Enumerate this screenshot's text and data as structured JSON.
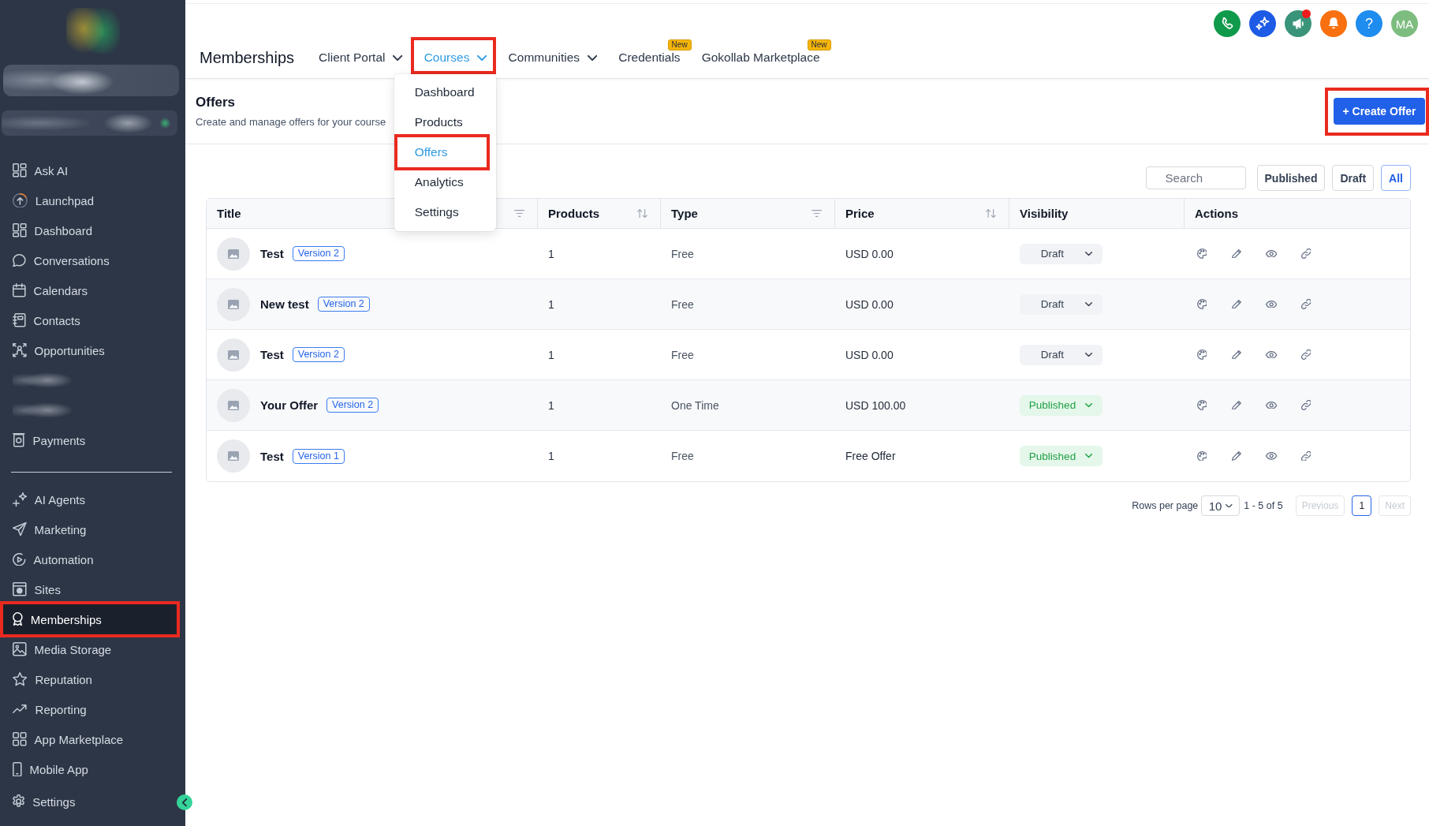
{
  "sidebar": {
    "main_items": [
      {
        "kind": "link",
        "label": "Ask AI",
        "selected": false,
        "highlighted": false
      },
      {
        "kind": "link",
        "label": "Launchpad",
        "selected": false,
        "highlighted": false
      },
      {
        "kind": "link",
        "label": "Dashboard",
        "selected": false,
        "highlighted": false
      },
      {
        "kind": "link",
        "label": "Conversations",
        "selected": false,
        "highlighted": false
      },
      {
        "kind": "link",
        "label": "Calendars",
        "selected": false,
        "highlighted": false
      },
      {
        "kind": "link",
        "label": "Contacts",
        "selected": false,
        "highlighted": false
      },
      {
        "kind": "link",
        "label": "Opportunities",
        "selected": false,
        "highlighted": false
      },
      {
        "kind": "redacted",
        "selected": false,
        "highlighted": false
      },
      {
        "kind": "redacted",
        "selected": false,
        "highlighted": false
      },
      {
        "kind": "link",
        "label": "Payments",
        "selected": false,
        "highlighted": false
      }
    ],
    "tool_items": [
      {
        "kind": "link",
        "label": "AI Agents",
        "selected": false,
        "highlighted": false
      },
      {
        "kind": "link",
        "label": "Marketing",
        "selected": false,
        "highlighted": false
      },
      {
        "kind": "link",
        "label": "Automation",
        "selected": false,
        "highlighted": false
      },
      {
        "kind": "link",
        "label": "Sites",
        "selected": false,
        "highlighted": false
      },
      {
        "kind": "link",
        "label": "Memberships",
        "selected": true,
        "highlighted": true
      },
      {
        "kind": "link",
        "label": "Media Storage",
        "selected": false,
        "highlighted": false
      },
      {
        "kind": "link",
        "label": "Reputation",
        "selected": false,
        "highlighted": false
      },
      {
        "kind": "link",
        "label": "Reporting",
        "selected": false,
        "highlighted": false
      },
      {
        "kind": "link",
        "label": "App Marketplace",
        "selected": false,
        "highlighted": false
      },
      {
        "kind": "link",
        "label": "Mobile App",
        "selected": false,
        "highlighted": false
      }
    ],
    "footer_items": [
      {
        "kind": "link",
        "label": "Settings",
        "selected": false,
        "highlighted": false
      }
    ]
  },
  "header": {
    "title": "Memberships",
    "tabs": [
      {
        "label": "Client Portal",
        "selected": false,
        "highlighted": false,
        "menu": {
          "expanded": false
        }
      },
      {
        "label": "Courses",
        "selected": true,
        "highlighted": true,
        "menu": {
          "expanded": true,
          "items": [
            {
              "label": "Dashboard",
              "selected": false,
              "highlighted": false
            },
            {
              "label": "Products",
              "selected": false,
              "highlighted": false
            },
            {
              "label": "Offers",
              "selected": true,
              "highlighted": true
            },
            {
              "label": "Analytics",
              "selected": false,
              "highlighted": false
            },
            {
              "label": "Settings",
              "selected": false,
              "highlighted": false
            }
          ]
        }
      },
      {
        "label": "Communities",
        "selected": false,
        "highlighted": false,
        "menu": {
          "expanded": false
        }
      },
      {
        "label": "Credentials",
        "selected": false,
        "highlighted": false,
        "badge": "New"
      },
      {
        "label": "Gokollab Marketplace",
        "selected": false,
        "highlighted": false,
        "badge": "New"
      }
    ],
    "icon_buttons": [
      {
        "notification": false
      },
      {
        "notification": false
      },
      {
        "notification": true
      },
      {
        "notification": false
      }
    ],
    "help_button": {
      "symbol": "?"
    },
    "avatar": {
      "initials": "MA"
    }
  },
  "page_header": {
    "title": "Offers",
    "subtitle": "Create and manage offers for your course",
    "create_button": {
      "label": "+ Create Offer",
      "highlighted": true
    }
  },
  "toolbar": {
    "search": {
      "placeholder": "Search"
    },
    "status_filters": [
      {
        "label": "Published",
        "selected": false
      },
      {
        "label": "Draft",
        "selected": false
      },
      {
        "label": "All",
        "selected": true
      }
    ]
  },
  "table": {
    "columns": [
      {
        "label": "Title",
        "filterable": true,
        "sortable": false
      },
      {
        "label": "Products",
        "filterable": false,
        "sortable": true
      },
      {
        "label": "Type",
        "filterable": true,
        "sortable": false
      },
      {
        "label": "Price",
        "filterable": false,
        "sortable": true
      },
      {
        "label": "Visibility",
        "filterable": false,
        "sortable": false
      },
      {
        "label": "Actions",
        "filterable": false,
        "sortable": false
      }
    ],
    "rows": [
      {
        "title": "Test",
        "version": "Version 2",
        "products": "1",
        "type": "Free",
        "price": "USD 0.00",
        "visibility": {
          "label": "Draft",
          "kind": "draft"
        }
      },
      {
        "title": "New test",
        "version": "Version 2",
        "products": "1",
        "type": "Free",
        "price": "USD 0.00",
        "visibility": {
          "label": "Draft",
          "kind": "draft"
        }
      },
      {
        "title": "Test",
        "version": "Version 2",
        "products": "1",
        "type": "Free",
        "price": "USD 0.00",
        "visibility": {
          "label": "Draft",
          "kind": "draft"
        }
      },
      {
        "title": "Your Offer",
        "version": "Version 2",
        "products": "1",
        "type": "One Time",
        "price": "USD 100.00",
        "visibility": {
          "label": "Published",
          "kind": "published"
        }
      },
      {
        "title": "Test",
        "version": "Version 1",
        "products": "1",
        "type": "Free",
        "price": "Free Offer",
        "visibility": {
          "label": "Published",
          "kind": "published"
        }
      }
    ]
  },
  "pagination": {
    "rows_label": "Rows per page",
    "rows_per_page": "10",
    "range": "1 - 5 of 5",
    "previous": {
      "label": "Previous",
      "disabled": true
    },
    "pages": [
      {
        "label": "1",
        "selected": true
      }
    ],
    "next": {
      "label": "Next",
      "disabled": true
    }
  }
}
